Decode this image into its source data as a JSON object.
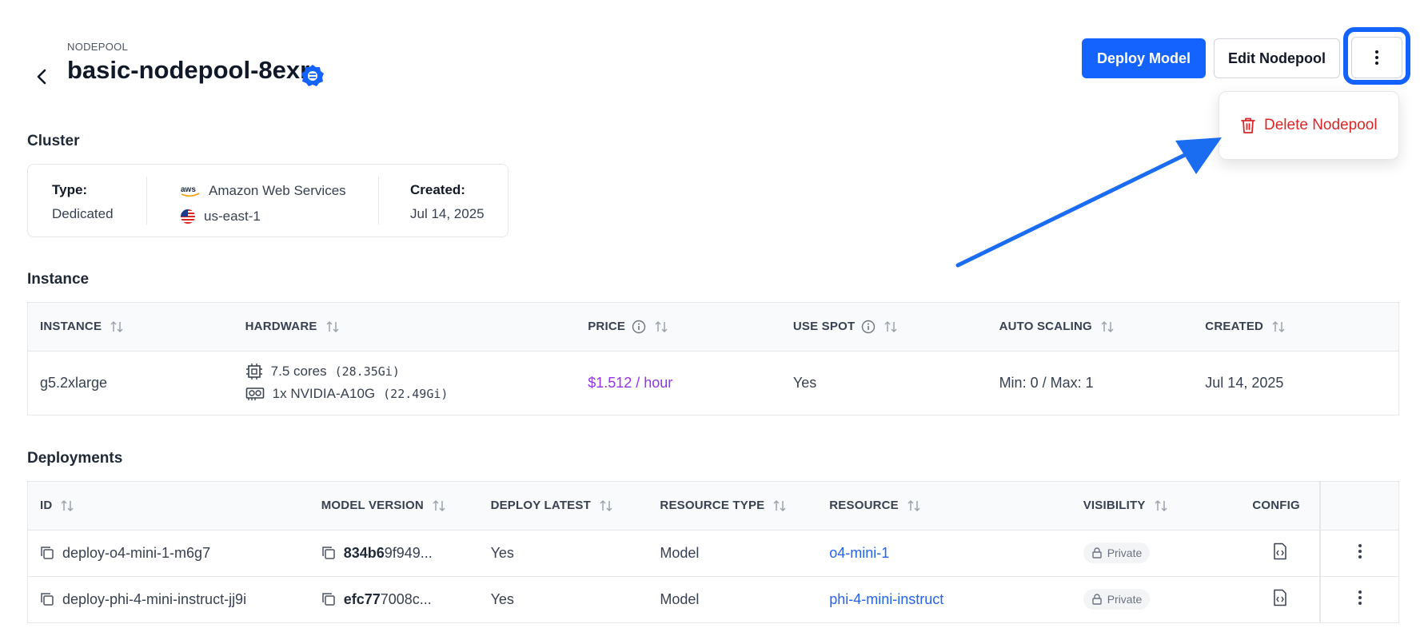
{
  "header": {
    "eyebrow": "NODEPOOL",
    "title": "basic-nodepool-8exr",
    "deploy_label": "Deploy Model",
    "edit_label": "Edit Nodepool"
  },
  "dropdown": {
    "delete_label": "Delete Nodepool"
  },
  "cluster": {
    "section_title": "Cluster",
    "type_label": "Type:",
    "type_value": "Dedicated",
    "provider_logo": "aws",
    "provider": "Amazon Web Services",
    "region": "us-east-1",
    "created_label": "Created:",
    "created_value": "Jul 14, 2025"
  },
  "instance": {
    "section_title": "Instance",
    "columns": [
      "INSTANCE",
      "HARDWARE",
      "PRICE",
      "USE SPOT",
      "AUTO SCALING",
      "CREATED"
    ],
    "row": {
      "instance": "g5.2xlarge",
      "cpu": "7.5 cores",
      "cpu_mem": "(28.35Gi)",
      "gpu": "1x NVIDIA-A10G",
      "gpu_mem": "(22.49Gi)",
      "price": "$1.512 / hour",
      "use_spot": "Yes",
      "auto_scaling": "Min: 0 / Max: 1",
      "created": "Jul 14, 2025"
    }
  },
  "deployments": {
    "section_title": "Deployments",
    "columns": [
      "ID",
      "MODEL VERSION",
      "DEPLOY LATEST",
      "RESOURCE TYPE",
      "RESOURCE",
      "VISIBILITY",
      "CONFIG"
    ],
    "rows": [
      {
        "id": "deploy-o4-mini-1-m6g7",
        "version_bold": "834b6",
        "version_rest": "9f949...",
        "deploy_latest": "Yes",
        "resource_type": "Model",
        "resource": "o4-mini-1",
        "visibility": "Private"
      },
      {
        "id": "deploy-phi-4-mini-instruct-jj9i",
        "version_bold": "efc77",
        "version_rest": "7008c...",
        "deploy_latest": "Yes",
        "resource_type": "Model",
        "resource": "phi-4-mini-instruct",
        "visibility": "Private"
      }
    ]
  },
  "colors": {
    "accent": "#1463ff",
    "danger": "#dc2626",
    "price": "#9333ea",
    "link": "#2563eb"
  }
}
